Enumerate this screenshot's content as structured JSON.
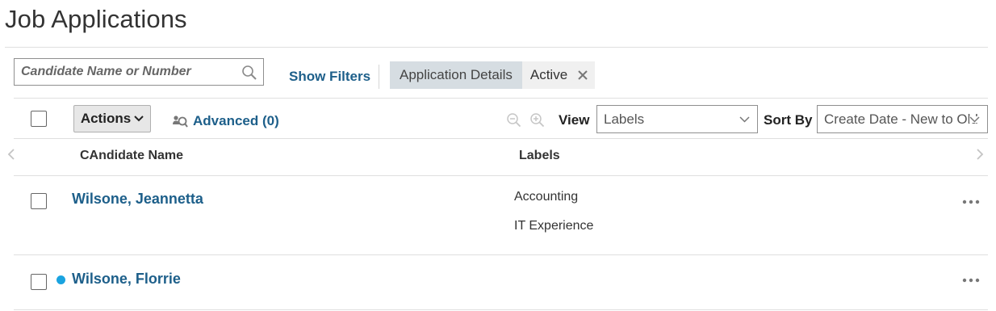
{
  "page": {
    "title": "Job Applications"
  },
  "search": {
    "placeholder": "Candidate Name or Number"
  },
  "filters": {
    "show_filters_label": "Show Filters",
    "chips": [
      {
        "label": "Application Details"
      },
      {
        "label": "Active"
      }
    ]
  },
  "toolbar": {
    "actions_label": "Actions",
    "advanced_label": "Advanced (0)",
    "view_label": "View",
    "view_selected": "Labels",
    "sort_label": "Sort By",
    "sort_selected": "Create Date - New to Old"
  },
  "table": {
    "columns": [
      {
        "label": "CAndidate Name"
      },
      {
        "label": "Labels"
      }
    ],
    "rows": [
      {
        "name": "Wilsone, Jeannetta",
        "labels": [
          "Accounting",
          "IT Experience"
        ],
        "new_indicator": false
      },
      {
        "name": "Wilsone, Florrie",
        "labels": [],
        "new_indicator": true
      }
    ]
  },
  "colors": {
    "link": "#1d5f8a",
    "new_dot": "#1aa3e0",
    "chip_active_bg": "#d6dde2"
  },
  "icons": [
    "search-icon",
    "close-icon",
    "chevron-down-icon",
    "advanced-search-icon",
    "zoom-out-icon",
    "zoom-in-icon",
    "chevron-left-icon",
    "chevron-right-icon",
    "more-options-icon"
  ]
}
